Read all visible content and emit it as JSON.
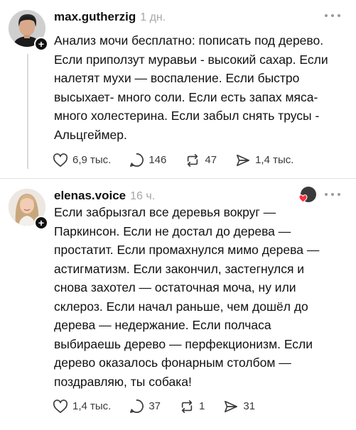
{
  "posts": [
    {
      "username": "max.gutherzig",
      "time": "1 дн.",
      "lines": [
        "Анализ мочи бесплатно: пописать под дерево.",
        "Если приползут муравьи - высокий сахар. Если",
        "налетят мухи — воспаление. Если быстро",
        "высыхает- много соли. Если есть запах мяса-",
        "много холестерина. Если забыл снять трусы -",
        "Альцгеймер."
      ],
      "likes": "6,9 тыс.",
      "replies": "146",
      "reposts": "47",
      "shares": "1,4 тыс."
    },
    {
      "username": "elenas.voice",
      "time": "16 ч.",
      "lines": [
        "Если забрызгал все деревья вокруг —",
        "Паркинсон. Если не достал до дерева —",
        "простатит.  Если промахнулся мимо дерева —",
        "астигматизм.  Если закончил, застегнулся и",
        "снова захотел — остаточная моча, ну или",
        "склероз. Если начал раньше, чем дошёл до",
        "дерева — недержание. Если полчаса",
        "выбираешь дерево — перфекционизм. Если",
        "дерево оказалось фонарным столбом —",
        "поздравляю, ты собака!"
      ],
      "likes": "1,4 тыс.",
      "replies": "37",
      "reposts": "1",
      "shares": "31"
    }
  ],
  "icons": {
    "like": "heart-icon",
    "reply": "comment-icon",
    "repost": "repost-icon",
    "share": "send-icon",
    "follow": "plus-icon",
    "more": "more-icon"
  },
  "colors": {
    "text": "#111111",
    "muted": "#a7a7a7",
    "like_badge": "#ff3040"
  }
}
